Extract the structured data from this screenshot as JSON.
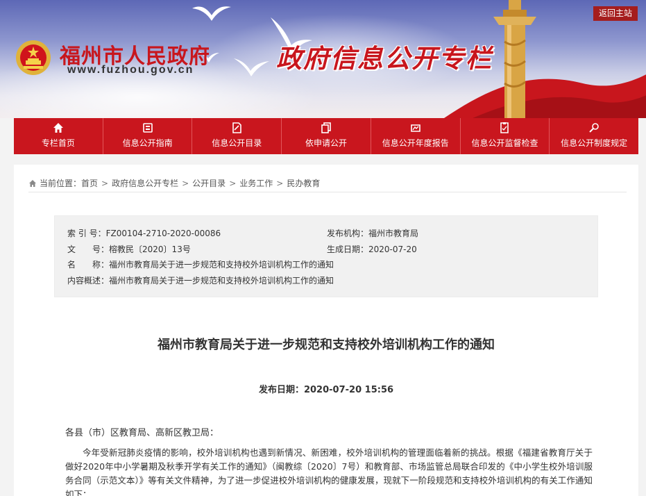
{
  "header": {
    "site_name": "福州市人民政府",
    "site_url": "www.fuzhou.gov.cn",
    "column_title": "政府信息公开专栏",
    "back_link": "返回主站"
  },
  "nav": [
    {
      "label": "专栏首页",
      "icon": "home-icon"
    },
    {
      "label": "信息公开指南",
      "icon": "guide-icon"
    },
    {
      "label": "信息公开目录",
      "icon": "catalog-icon"
    },
    {
      "label": "依申请公开",
      "icon": "copy-icon"
    },
    {
      "label": "信息公开年度报告",
      "icon": "report-icon"
    },
    {
      "label": "信息公开监督检查",
      "icon": "inspect-icon"
    },
    {
      "label": "信息公开制度规定",
      "icon": "rule-icon"
    }
  ],
  "breadcrumb": {
    "prefix": "当前位置：",
    "items": [
      "首页",
      "政府信息公开专栏",
      "公开目录",
      "业务工作",
      "民办教育"
    ]
  },
  "meta": {
    "index_label": "索 引 号：",
    "index_value": "FZ00104-2710-2020-00086",
    "publisher_label": "发布机构：",
    "publisher_value": "福州市教育局",
    "docno_label": "文　　号：",
    "docno_value": "榕教民〔2020〕13号",
    "created_label": "生成日期：",
    "created_value": "2020-07-20",
    "name_label": "名　　称：",
    "name_value": "福州市教育局关于进一步规范和支持校外培训机构工作的通知",
    "summary_label": "内容概述：",
    "summary_value": "福州市教育局关于进一步规范和支持校外培训机构工作的通知"
  },
  "article": {
    "title": "福州市教育局关于进一步规范和支持校外培训机构工作的通知",
    "date_label": "发布日期：",
    "date_value": "2020-07-20 15:56",
    "salutation": "各县（市）区教育局、高新区教卫局：",
    "paragraph": "今年受新冠肺炎疫情的影响，校外培训机构也遇到新情况、新困难，校外培训机构的管理面临着新的挑战。根据《福建省教育厅关于做好2020年中小学暑期及秋季开学有关工作的通知》（闽教综〔2020〕7号）和教育部、市场监管总局联合印发的《中小学生校外培训服务合同（示范文本）》等有关文件精神，为了进一步促进校外培训机构的健康发展，现就下一阶段规范和支持校外培训机构的有关工作通知如下："
  },
  "colors": {
    "brand_red": "#c9161e",
    "back_button": "#a51d1d",
    "meta_bg": "#f1f1f1"
  }
}
